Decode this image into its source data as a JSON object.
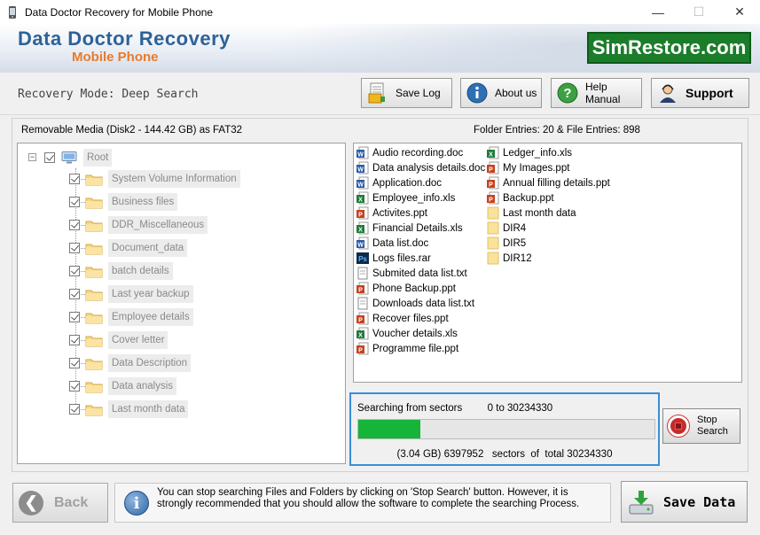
{
  "window": {
    "title": "Data Doctor Recovery for Mobile Phone",
    "minimize": "—",
    "maximize": "☐",
    "close": "✕"
  },
  "banner": {
    "brand": "Data Doctor Recovery",
    "subtitle": "Mobile Phone",
    "simrestore": "SimRestore.com"
  },
  "toolbar": {
    "mode": "Recovery Mode: Deep Search",
    "save_log": "Save Log",
    "about_us": "About us",
    "help_manual": "Help Manual",
    "support": "Support"
  },
  "media": {
    "label": "Removable Media (Disk2 - 144.42 GB) as FAT32",
    "entries": "Folder Entries: 20 & File Entries: 898"
  },
  "tree": {
    "root": "Root",
    "folders": [
      "System Volume Information",
      "Business files",
      "DDR_Miscellaneous",
      "Document_data",
      "batch details",
      "Last year backup",
      "Employee details",
      "Cover letter",
      "Data Description",
      "Data analysis",
      "Last month data"
    ]
  },
  "files": {
    "col1": [
      {
        "name": "Audio recording.doc",
        "type": "doc"
      },
      {
        "name": "Data analysis details.doc",
        "type": "doc"
      },
      {
        "name": "Application.doc",
        "type": "doc"
      },
      {
        "name": "Employee_info.xls",
        "type": "xls"
      },
      {
        "name": "Activites.ppt",
        "type": "ppt"
      },
      {
        "name": "Financial Details.xls",
        "type": "xls"
      },
      {
        "name": "Data list.doc",
        "type": "doc"
      },
      {
        "name": "Logs files.rar",
        "type": "psd"
      },
      {
        "name": "Submited data list.txt",
        "type": "txt"
      },
      {
        "name": "Phone Backup.ppt",
        "type": "ppt"
      },
      {
        "name": "Downloads data list.txt",
        "type": "txt"
      },
      {
        "name": "Recover files.ppt",
        "type": "ppt"
      },
      {
        "name": "Voucher details.xls",
        "type": "xls"
      },
      {
        "name": "Programme file.ppt",
        "type": "ppt"
      }
    ],
    "col2": [
      {
        "name": "Ledger_info.xls",
        "type": "xls"
      },
      {
        "name": "My Images.ppt",
        "type": "ppt"
      },
      {
        "name": "Annual filling details.ppt",
        "type": "ppt"
      },
      {
        "name": "Backup.ppt",
        "type": "ppt"
      },
      {
        "name": "Last month data",
        "type": "folder"
      },
      {
        "name": "DIR4",
        "type": "folder"
      },
      {
        "name": "DIR5",
        "type": "folder"
      },
      {
        "name": "DIR12",
        "type": "folder"
      }
    ]
  },
  "search": {
    "label": "Searching from sectors",
    "range": "0 to 30234330",
    "progress_fraction": 0.21,
    "stats": "(3.04 GB) 6397952   sectors  of  total 30234330",
    "stop_line1": "Stop",
    "stop_line2": "Search"
  },
  "bottom": {
    "back": "Back",
    "info_message": "You can stop searching Files and Folders by clicking on 'Stop Search' button. However, it is strongly recommended that you should allow the software to complete the searching Process.",
    "save_data": "Save Data"
  },
  "colors": {
    "brand_blue": "#2e6298",
    "subtitle_orange": "#e87a2a",
    "simrestore_green": "#1b7d2a",
    "progress_green": "#17b43a",
    "search_border": "#3a8ed6"
  }
}
